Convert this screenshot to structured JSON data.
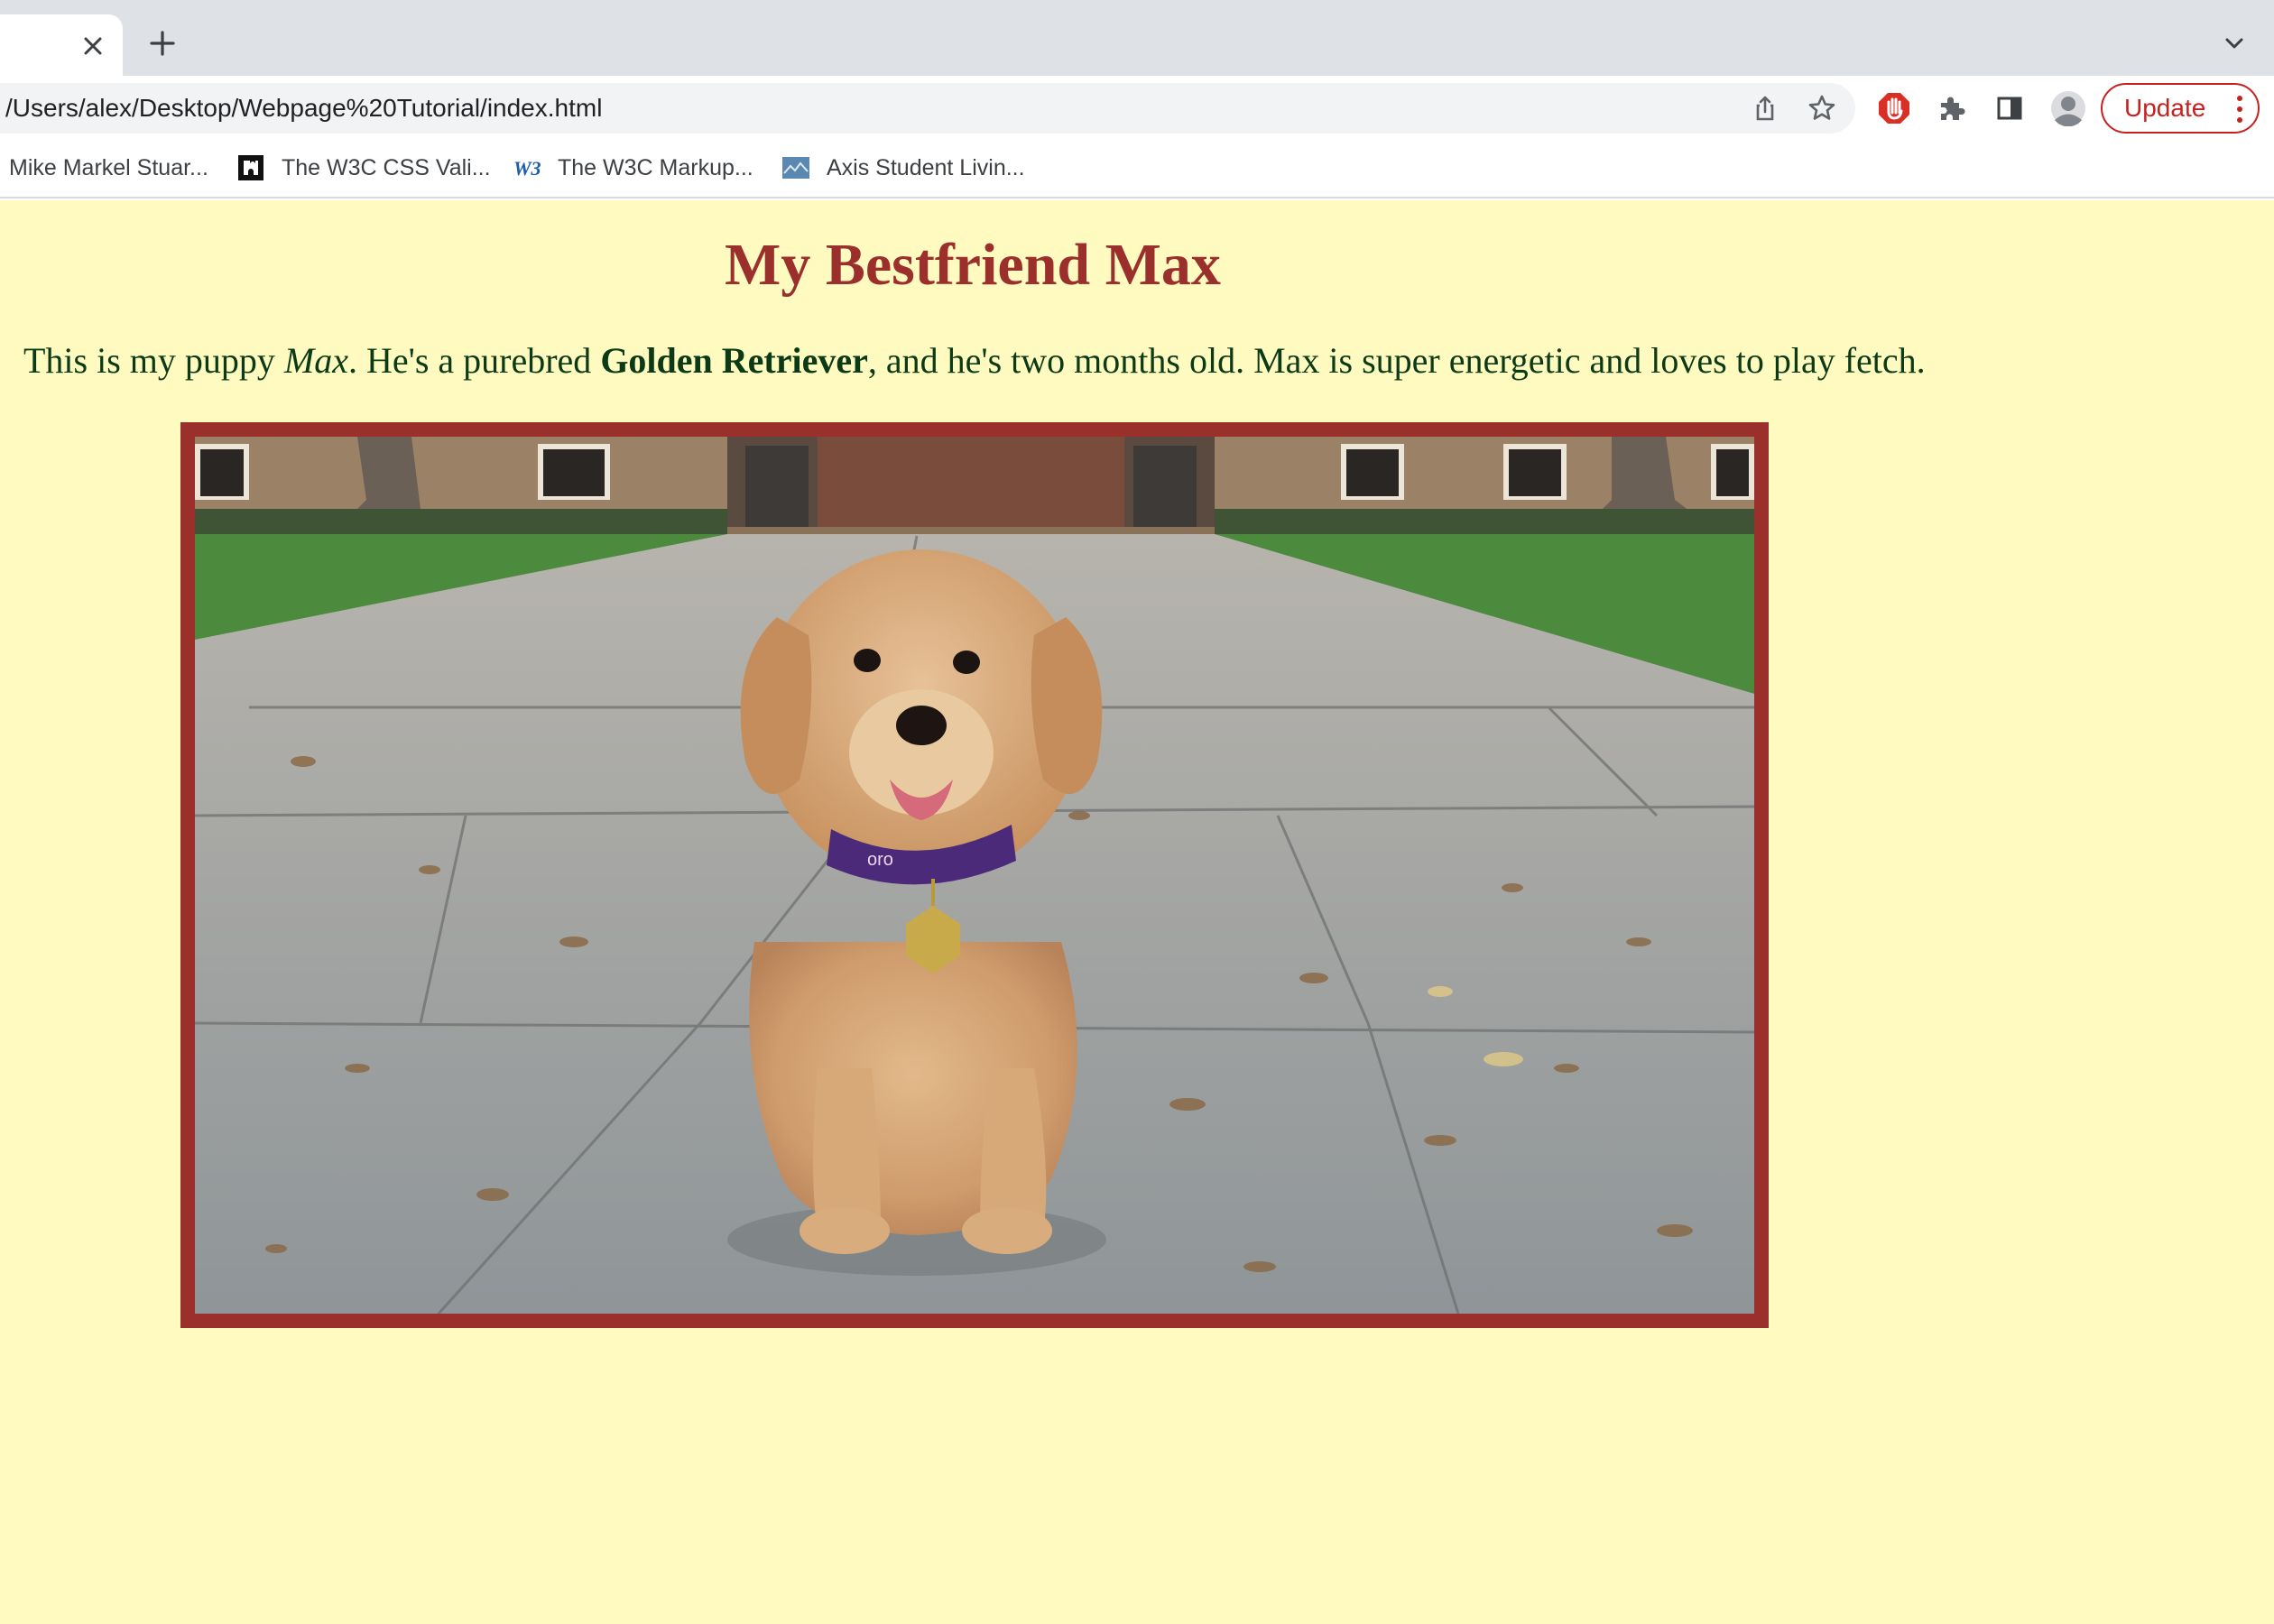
{
  "browser": {
    "tab": {
      "close_icon": "close-icon"
    },
    "new_tab_icon": "plus-icon",
    "tab_list_icon": "chevron-down-icon",
    "address_bar": {
      "url": "/Users/alex/Desktop/Webpage%20Tutorial/index.html",
      "share_icon": "share-icon",
      "bookmark_icon": "star-icon"
    },
    "toolbar": {
      "adblock_icon": "stop-hand-icon",
      "extensions_icon": "puzzle-icon",
      "side_panel_icon": "side-panel-icon",
      "profile_icon": "avatar-icon",
      "update_label": "Update",
      "menu_icon": "kebab-menu-icon"
    },
    "bookmarks": [
      {
        "label": "Mike Markel Stuar...",
        "icon": ""
      },
      {
        "label": "The W3C CSS Vali...",
        "icon": "puzzle-favicon"
      },
      {
        "label": "The W3C Markup...",
        "icon": "w3c-favicon"
      },
      {
        "label": "Axis Student Livin...",
        "icon": "image-favicon"
      }
    ],
    "colors": {
      "tabbar": "#dee1e6",
      "omnibox": "#f1f3f4",
      "update_accent": "#c5221f"
    }
  },
  "page": {
    "title": "My Bestfriend Max",
    "intro": {
      "part1": "This is my puppy ",
      "name": "Max",
      "part2": ". He's a purebred ",
      "breed": "Golden Retriever",
      "part3": ", and he's two months old. Max is super energetic and loves to play fetch."
    },
    "photo": "golden-retriever-puppy-photo",
    "colors": {
      "background": "#fffbc0",
      "heading": "#9b2f2b",
      "body_text": "#0d3a16",
      "frame": "#9b2f2b"
    }
  }
}
